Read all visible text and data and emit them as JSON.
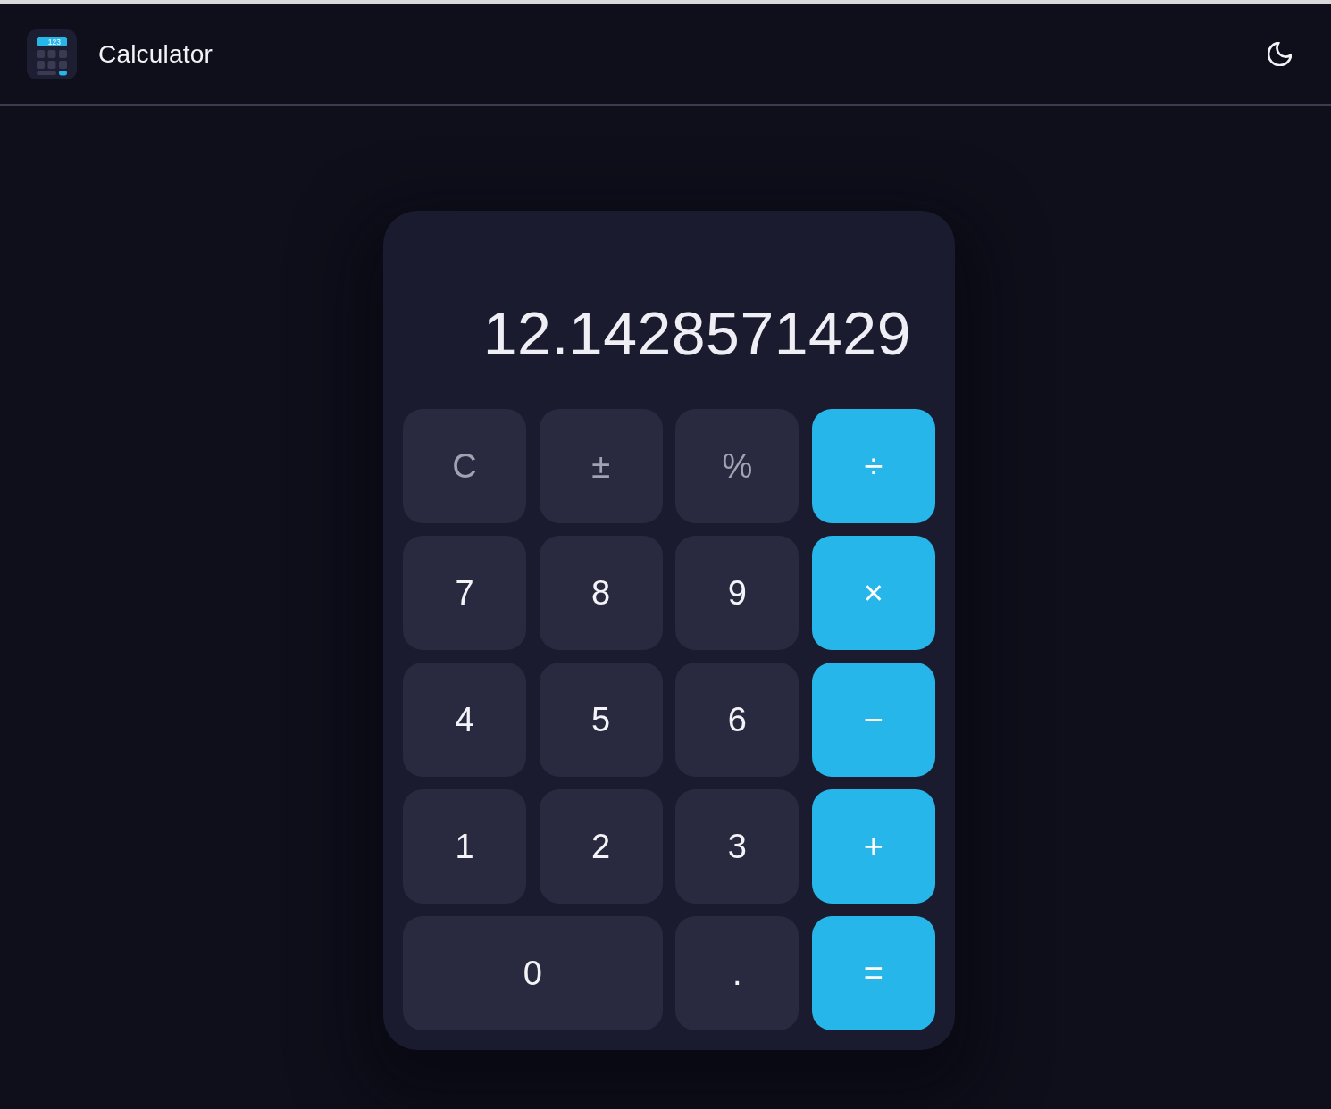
{
  "header": {
    "logo": {
      "text": "123"
    },
    "title": "Calculator"
  },
  "display": {
    "value": "12.1428571429"
  },
  "keys": [
    {
      "label": "C",
      "kind": "function",
      "wide": false
    },
    {
      "label": "±",
      "kind": "function",
      "wide": false
    },
    {
      "label": "%",
      "kind": "function",
      "wide": false
    },
    {
      "label": "÷",
      "kind": "operator",
      "wide": false
    },
    {
      "label": "7",
      "kind": "digit",
      "wide": false
    },
    {
      "label": "8",
      "kind": "digit",
      "wide": false
    },
    {
      "label": "9",
      "kind": "digit",
      "wide": false
    },
    {
      "label": "×",
      "kind": "operator",
      "wide": false
    },
    {
      "label": "4",
      "kind": "digit",
      "wide": false
    },
    {
      "label": "5",
      "kind": "digit",
      "wide": false
    },
    {
      "label": "6",
      "kind": "digit",
      "wide": false
    },
    {
      "label": "−",
      "kind": "operator",
      "wide": false
    },
    {
      "label": "1",
      "kind": "digit",
      "wide": false
    },
    {
      "label": "2",
      "kind": "digit",
      "wide": false
    },
    {
      "label": "3",
      "kind": "digit",
      "wide": false
    },
    {
      "label": "+",
      "kind": "operator",
      "wide": false
    },
    {
      "label": "0",
      "kind": "digit",
      "wide": true
    },
    {
      "label": ".",
      "kind": "digit",
      "wide": false
    },
    {
      "label": "=",
      "kind": "operator",
      "wide": false
    }
  ]
}
